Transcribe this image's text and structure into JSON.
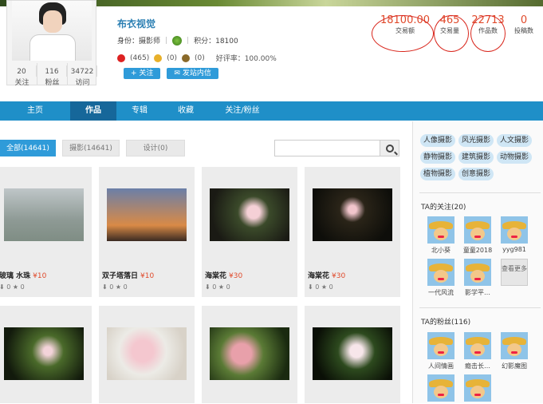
{
  "profile": {
    "name": "布衣视觉",
    "identity": "身份：摄影师",
    "score": "积分：18100",
    "flowers": [
      {
        "v": "(465)",
        "c": "#d22"
      },
      {
        "v": "(0)",
        "c": "#e8b02a"
      },
      {
        "v": "(0)",
        "c": "#8a6a2a"
      }
    ],
    "rating": "好评率：100.00%",
    "follow_btn": "+ 关注",
    "msg_btn": "发站内信",
    "following": {
      "num": "20",
      "label": "关注"
    },
    "fans": {
      "num": "116",
      "label": "粉丝"
    },
    "visits": {
      "num": "34722",
      "label": "访问"
    }
  },
  "bigstats": [
    {
      "num": "18100.00",
      "label": "交易额"
    },
    {
      "num": "465",
      "label": "交易量"
    },
    {
      "num": "22713",
      "label": "作品数"
    },
    {
      "num": "0",
      "label": "投稿数"
    }
  ],
  "nav": [
    "主页",
    "作品",
    "专辑",
    "收藏",
    "关注/粉丝"
  ],
  "subtabs": [
    "全部(14641)",
    "摄影(14641)",
    "设计(0)"
  ],
  "works": [
    {
      "title": "玻璃 水珠",
      "price": "¥10",
      "likes": "0",
      "stars": "0"
    },
    {
      "title": "双子塔落日",
      "price": "¥10",
      "likes": "0",
      "stars": "0"
    },
    {
      "title": "海棠花",
      "price": "¥30",
      "likes": "0",
      "stars": "0"
    },
    {
      "title": "海棠花",
      "price": "¥30",
      "likes": "0",
      "stars": "0"
    }
  ],
  "sidebar": {
    "tags": [
      "人像摄影",
      "风光摄影",
      "人文摄影",
      "静物摄影",
      "建筑摄影",
      "动物摄影",
      "植物摄影",
      "创意摄影"
    ],
    "following_title": "TA的关注(20)",
    "following": [
      "北小葵",
      "童童2018",
      "yyg981",
      "一代风流",
      "影学平…"
    ],
    "fans_title": "TA的粉丝(116)",
    "fans": [
      "人间情画",
      "瘾击长…",
      "幻影魔图"
    ],
    "more": "查看更多"
  },
  "colors": {
    "accent": "#1f8fc8",
    "price": "#e04a2b",
    "circle": "#d9261c"
  }
}
